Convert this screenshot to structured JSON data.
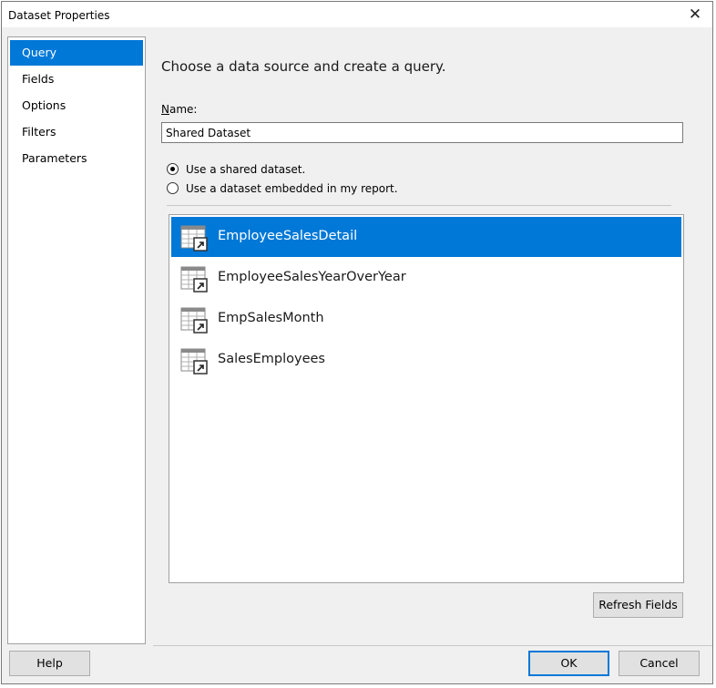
{
  "window": {
    "title": "Dataset Properties",
    "close_label": "✕"
  },
  "sidebar": {
    "items": [
      {
        "label": "Query"
      },
      {
        "label": "Fields"
      },
      {
        "label": "Options"
      },
      {
        "label": "Filters"
      },
      {
        "label": "Parameters"
      }
    ],
    "active": "Query"
  },
  "main": {
    "heading": "Choose a data source and create a query.",
    "name_label_accel": "N",
    "name_label_rest": "ame:",
    "name_value": "Shared Dataset",
    "radios": [
      {
        "label": "Use a shared dataset.",
        "checked": true
      },
      {
        "label": "Use a dataset embedded in my report.",
        "checked": false
      }
    ],
    "datasets": [
      {
        "label": "EmployeeSalesDetail",
        "icon": "shared-dataset-icon",
        "selected": true
      },
      {
        "label": "EmployeeSalesYearOverYear",
        "icon": "shared-dataset-icon",
        "selected": false
      },
      {
        "label": "EmpSalesMonth",
        "icon": "shared-dataset-icon",
        "selected": false
      },
      {
        "label": "SalesEmployees",
        "icon": "shared-dataset-icon",
        "selected": false
      }
    ],
    "refresh_label": "Refresh Fields"
  },
  "footer": {
    "help_label": "Help",
    "ok_label": "OK",
    "cancel_label": "Cancel"
  },
  "colors": {
    "accent": "#0078d7",
    "dialog_bg": "#f0f0f0"
  }
}
